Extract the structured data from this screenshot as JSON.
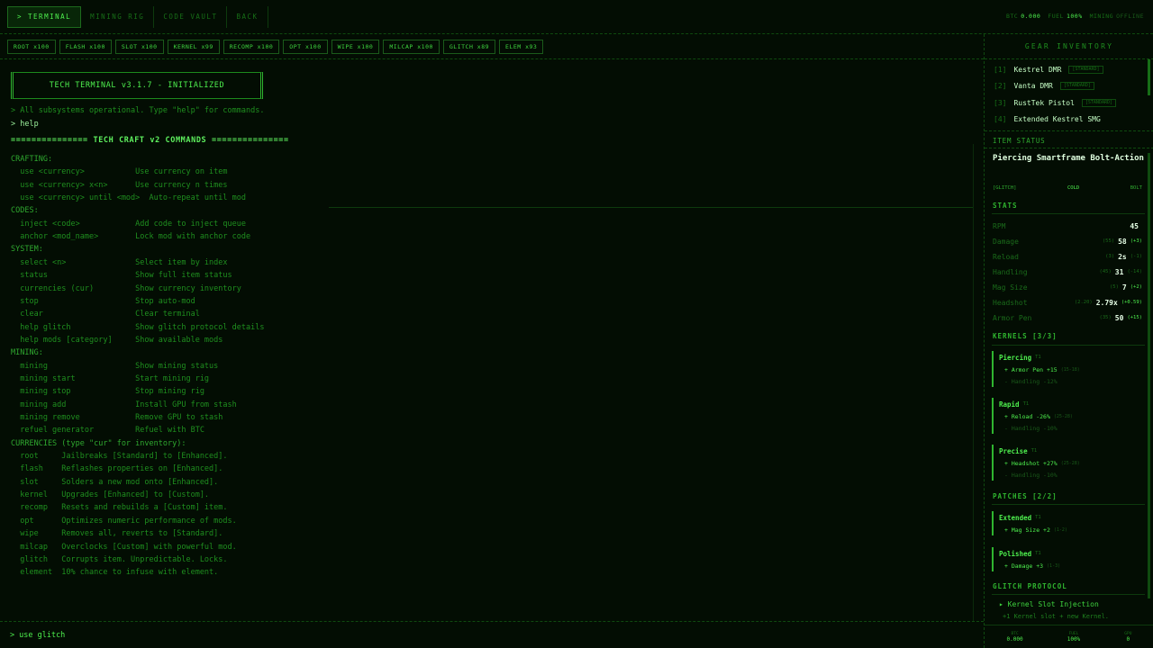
{
  "tabs": [
    {
      "label": "> TERMINAL"
    },
    {
      "label": "MINING RIG"
    },
    {
      "label": "CODE VAULT"
    },
    {
      "label": "BACK"
    }
  ],
  "status": {
    "btc_label": "BTC",
    "btc_value": "0.000",
    "fuel_label": "FUEL",
    "fuel_value": "100%",
    "mining_label": "MINING",
    "mining_value": "OFFLINE"
  },
  "currencies": [
    {
      "label": "ROOT x100"
    },
    {
      "label": "FLASH x100"
    },
    {
      "label": "SLOT x100"
    },
    {
      "label": "KERNEL x99"
    },
    {
      "label": "RECOMP x100"
    },
    {
      "label": "OPT x100"
    },
    {
      "label": "WIPE x100"
    },
    {
      "label": "MILCAP x100"
    },
    {
      "label": "GLITCH x89"
    },
    {
      "label": "ELEM x93"
    }
  ],
  "terminal": {
    "banner": "TECH TERMINAL v3.1.7 - INITIALIZED",
    "intro": "> All subsystems operational. Type \"help\" for commands.",
    "echo": "> help",
    "header": "=============== TECH CRAFT v2 COMMANDS ===============",
    "lines": [
      "CRAFTING:",
      "  use <currency>           Use currency on item",
      "  use <currency> x<n>      Use currency n times",
      "  use <currency> until <mod>  Auto-repeat until mod",
      "CODES:",
      "  inject <code>            Add code to inject queue",
      "  anchor <mod_name>        Lock mod with anchor code",
      "SYSTEM:",
      "  select <n>               Select item by index",
      "  status                   Show full item status",
      "  currencies (cur)         Show currency inventory",
      "  stop                     Stop auto-mod",
      "  clear                    Clear terminal",
      "  help glitch              Show glitch protocol details",
      "  help mods [category]     Show available mods",
      "MINING:",
      "  mining                   Show mining status",
      "  mining start             Start mining rig",
      "  mining stop              Stop mining rig",
      "  mining add               Install GPU from stash",
      "  mining remove            Remove GPU to stash",
      "  refuel generator         Refuel with BTC",
      "CURRENCIES (type \"cur\" for inventory):",
      "  root     Jailbreaks [Standard] to [Enhanced].",
      "  flash    Reflashes properties on [Enhanced].",
      "  slot     Solders a new mod onto [Enhanced].",
      "  kernel   Upgrades [Enhanced] to [Custom].",
      "  recomp   Resets and rebuilds a [Custom] item.",
      "  opt      Optimizes numeric performance of mods.",
      "  wipe     Removes all, reverts to [Standard].",
      "  milcap   Overclocks [Custom] with powerful mod.",
      "  glitch   Corrupts item. Unpredictable. Locks.",
      "  element  10% chance to infuse with element."
    ],
    "input_prompt": ">",
    "input_value": "use glitch"
  },
  "inventory": {
    "title": "GEAR INVENTORY",
    "items": [
      {
        "idx": "[1]",
        "name": "Kestrel DMR",
        "tag": "[STANDARD]"
      },
      {
        "idx": "[2]",
        "name": "Vanta DMR",
        "tag": "[STANDARD]"
      },
      {
        "idx": "[3]",
        "name": "RustTek Pistol",
        "tag": "[STANDARD]"
      },
      {
        "idx": "[4]",
        "name": "Extended Kestrel SMG",
        "tag": ""
      }
    ]
  },
  "item_status": {
    "label": "ITEM STATUS",
    "name": "Piercing Smartframe Bolt-Action",
    "tag_left": "[GLITCH]",
    "tag_mid": "COLD",
    "tag_right": "BOLT",
    "stats_label": "STATS",
    "stats": [
      {
        "label": "RPM",
        "base": "",
        "value": "45",
        "delta": "",
        "neg": false
      },
      {
        "label": "Damage",
        "base": "(55)",
        "value": "58",
        "delta": "(+3)",
        "neg": false
      },
      {
        "label": "Reload",
        "base": "(3)",
        "value": "2s",
        "delta": "(-1)",
        "neg": true
      },
      {
        "label": "Handling",
        "base": "(45)",
        "value": "31",
        "delta": "(-14)",
        "neg": true
      },
      {
        "label": "Mag Size",
        "base": "(5)",
        "value": "7",
        "delta": "(+2)",
        "neg": false
      },
      {
        "label": "Headshot",
        "base": "(2.20)",
        "value": "2.79x",
        "delta": "(+0.59)",
        "neg": false
      },
      {
        "label": "Armor Pen",
        "base": "(35)",
        "value": "50",
        "delta": "(+15)",
        "neg": false
      }
    ]
  },
  "kernels": {
    "label": "KERNELS [3/3]",
    "mods": [
      {
        "name": "Piercing",
        "tier": "T1",
        "pos": "+ Armor Pen +15",
        "pos_range": "(15-18)",
        "neg": "- Handling -12%"
      },
      {
        "name": "Rapid",
        "tier": "T1",
        "pos": "+ Reload -26%",
        "pos_range": "(25-28)",
        "neg": "- Handling -10%"
      },
      {
        "name": "Precise",
        "tier": "T1",
        "pos": "+ Headshot +27%",
        "pos_range": "(25-28)",
        "neg": "- Handling -10%"
      }
    ]
  },
  "patches": {
    "label": "PATCHES [2/2]",
    "mods": [
      {
        "name": "Extended",
        "tier": "T1",
        "pos": "+ Mag Size +2",
        "pos_range": "(1-2)"
      },
      {
        "name": "Polished",
        "tier": "T1",
        "pos": "+ Damage +3",
        "pos_range": "(1-3)"
      }
    ]
  },
  "glitch_protocol": {
    "label": "GLITCH PROTOCOL",
    "line": "▸ Kernel Slot Injection",
    "sub": "+1 Kernel slot + new Kernel."
  },
  "footer": [
    {
      "label": "BTC",
      "value": "0.000"
    },
    {
      "label": "FUEL",
      "value": "100%"
    },
    {
      "label": "GPU",
      "value": "0"
    }
  ]
}
